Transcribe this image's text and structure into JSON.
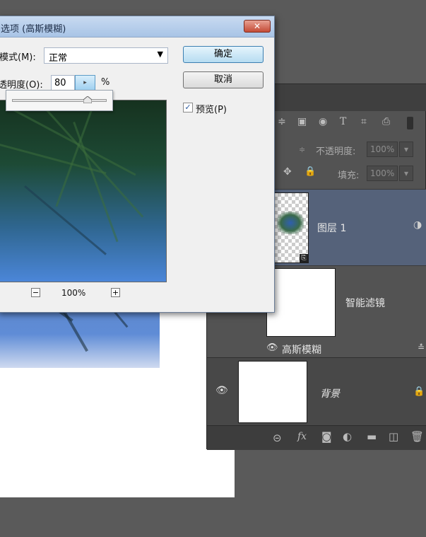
{
  "dialog": {
    "title": "选项 (高斯模糊)",
    "close_label": "✕",
    "mode_label": "模式(M):",
    "mode_value": "正常",
    "opacity_label": "透明度(O):",
    "opacity_value": "80",
    "opacity_unit": "%",
    "ok_label": "确定",
    "cancel_label": "取消",
    "preview_label": "预览(P)",
    "preview_checked": true,
    "zoom_minus": "−",
    "zoom_value": "100%",
    "zoom_plus": "+",
    "slider_value_fraction": 0.8
  },
  "layers_panel": {
    "tools": [
      "≑",
      "▣",
      "◉",
      "T",
      "⌗",
      "⎙"
    ],
    "opacity_label": "不透明度:",
    "opacity_value": "100%",
    "fill_label": "填充:",
    "fill_value": "100%",
    "lock_icons": [
      "✥",
      "🔒"
    ],
    "layers": [
      {
        "name": "图层 1",
        "selected": true
      },
      {
        "name": "智能滤镜",
        "selected": false
      },
      {
        "name": "高斯模糊",
        "selected": false
      },
      {
        "name": "背景",
        "selected": false
      }
    ],
    "footer_icons": [
      "link",
      "fx",
      "mask",
      "adjust",
      "folder",
      "new",
      "trash"
    ],
    "footer_fx": "fx"
  },
  "colors": {
    "selected_layer": "#55627a",
    "panel_bg": "#535353",
    "dialog_bg": "#f0f0f0",
    "accent": "#3c7fb1"
  }
}
